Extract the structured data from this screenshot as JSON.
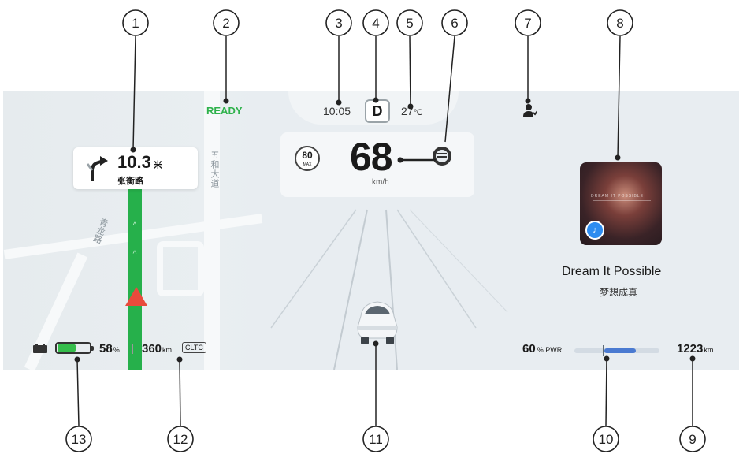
{
  "navigation": {
    "distance": "10.3",
    "distance_unit": "米",
    "street": "张衡路",
    "road_labels": [
      "五和大道",
      "青龙路"
    ],
    "route_color": "#26b04b"
  },
  "status": {
    "ready_text": "READY",
    "ready_color": "#2fb24c"
  },
  "top_bar": {
    "time": "10:05",
    "gear": "D",
    "temperature": "27",
    "temperature_unit": "℃"
  },
  "speed": {
    "value": "68",
    "unit": "km/h",
    "limit": "80",
    "limit_label": "MAX"
  },
  "media": {
    "title": "Dream It Possible",
    "subtitle": "梦想成真",
    "album_text": "DREAM IT POSSIBLE",
    "badge_icon": "music-note-icon"
  },
  "battery": {
    "percent": "58",
    "percent_unit": "%",
    "level": 0.58,
    "range": "360",
    "range_unit": "km",
    "cycle": "CLTC",
    "fill_color": "#35bd4b"
  },
  "power": {
    "percent": "60",
    "percent_unit": "%",
    "label": "PWR",
    "bar_color": "#4a7ad1"
  },
  "odometer": {
    "value": "1223",
    "unit": "km"
  },
  "icons": {
    "profile": "driver-profile-icon",
    "assist": "driving-assist-icon",
    "battery_status": "battery-status-icon",
    "turn": "turn-right-arrow-icon"
  },
  "callouts": [
    "1",
    "2",
    "3",
    "4",
    "5",
    "6",
    "7",
    "8",
    "9",
    "10",
    "11",
    "12",
    "13"
  ]
}
